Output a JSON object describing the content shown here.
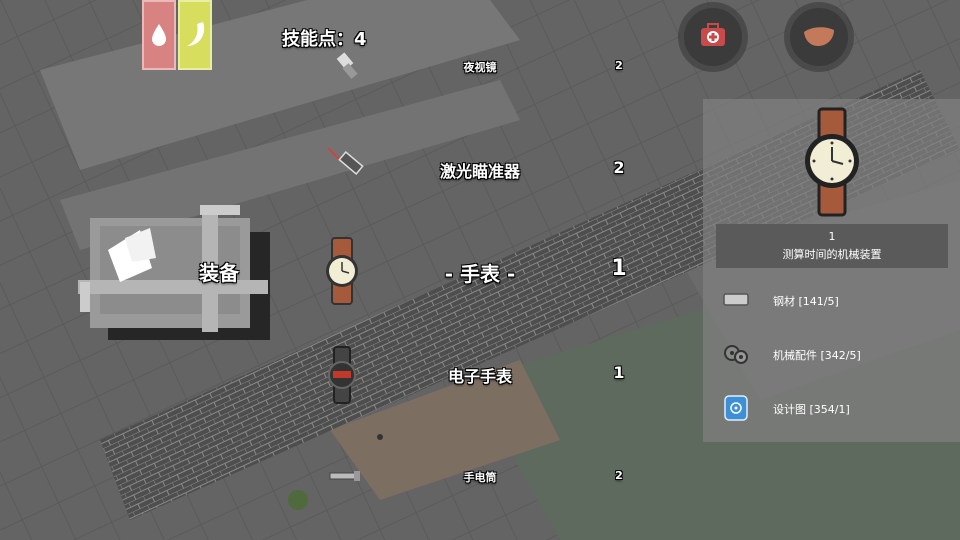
{
  "hud": {
    "skill_points": "技能点：4",
    "status_bars": [
      {
        "id": "water",
        "color": "#d98282"
      },
      {
        "id": "food",
        "color": "#d7dd5c"
      }
    ],
    "buttons": [
      {
        "id": "medkit",
        "icon": "medkit-icon"
      },
      {
        "id": "leather",
        "icon": "leather-icon"
      }
    ]
  },
  "equipment": {
    "label": "装备"
  },
  "craft_list": [
    {
      "name": "夜视镜",
      "count": "2",
      "icon": "night-vision-icon"
    },
    {
      "name": "激光瞄准器",
      "count": "2",
      "icon": "laser-sight-icon"
    },
    {
      "name": "- 手表 -",
      "count": "1",
      "icon": "watch-icon"
    },
    {
      "name": "电子手表",
      "count": "1",
      "icon": "digital-watch-icon"
    },
    {
      "name": "手电筒",
      "count": "2",
      "icon": "flashlight-icon"
    }
  ],
  "detail": {
    "quantity": "1",
    "description": "测算时间的机械装置",
    "materials": [
      {
        "label": "钢材 [141/5]",
        "icon": "steel-icon"
      },
      {
        "label": "机械配件 [342/5]",
        "icon": "mechanical-parts-icon"
      },
      {
        "label": "设计图 [354/1]",
        "icon": "blueprint-icon"
      }
    ]
  }
}
